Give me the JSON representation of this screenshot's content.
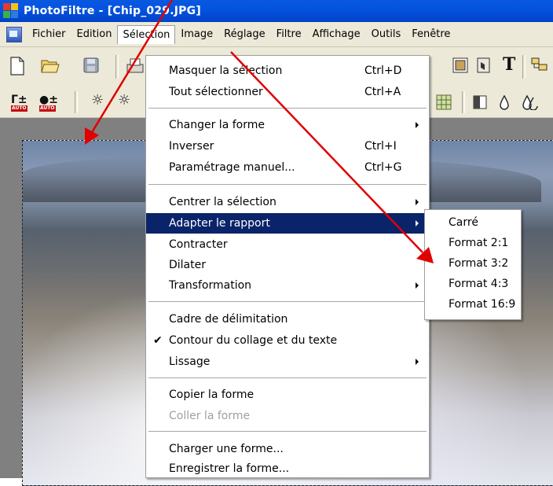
{
  "window": {
    "app_name": "PhotoFiltre",
    "title": "PhotoFiltre - [Chip_029.JPG]"
  },
  "menubar": {
    "items": [
      {
        "label": "Fichier"
      },
      {
        "label": "Edition"
      },
      {
        "label": "Sélection",
        "open": true
      },
      {
        "label": "Image"
      },
      {
        "label": "Réglage"
      },
      {
        "label": "Filtre"
      },
      {
        "label": "Affichage"
      },
      {
        "label": "Outils"
      },
      {
        "label": "Fenêtre"
      }
    ]
  },
  "selection_menu": {
    "items": [
      {
        "label": "Masquer la sélection",
        "shortcut": "Ctrl+D"
      },
      {
        "label": "Tout sélectionner",
        "shortcut": "Ctrl+A"
      },
      {
        "label": "Changer la forme",
        "submenu": true
      },
      {
        "label": "Inverser",
        "shortcut": "Ctrl+I"
      },
      {
        "label": "Paramétrage manuel...",
        "shortcut": "Ctrl+G"
      },
      {
        "label": "Centrer la sélection",
        "submenu": true
      },
      {
        "label": "Adapter le rapport",
        "submenu": true,
        "highlighted": true
      },
      {
        "label": "Contracter"
      },
      {
        "label": "Dilater"
      },
      {
        "label": "Transformation",
        "submenu": true
      },
      {
        "label": "Cadre de délimitation"
      },
      {
        "label": "Contour du collage et du texte",
        "checked": true
      },
      {
        "label": "Lissage",
        "submenu": true
      },
      {
        "label": "Copier la forme"
      },
      {
        "label": "Coller la forme",
        "disabled": true
      },
      {
        "label": "Charger une forme..."
      },
      {
        "label": "Enregistrer la forme..."
      }
    ]
  },
  "ratio_submenu": {
    "items": [
      {
        "label": "Carré"
      },
      {
        "label": "Format 2:1"
      },
      {
        "label": "Format 3:2"
      },
      {
        "label": "Format 4:3"
      },
      {
        "label": "Format 16:9"
      }
    ]
  },
  "toolbar": {
    "auto_label": "AUTO",
    "text_tool_glyph": "T"
  },
  "colors": {
    "titlebar": "#0454e0",
    "chrome": "#ece9d8",
    "menu_highlight": "#0a246a",
    "annotation_arrow": "#e00000"
  }
}
